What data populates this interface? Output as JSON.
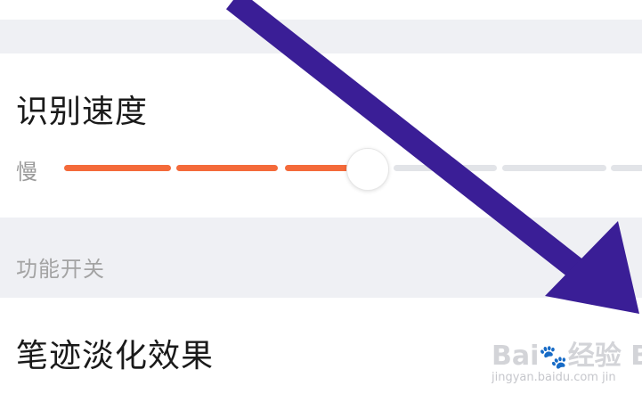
{
  "speed": {
    "title": "识别速度",
    "slow_label": "慢",
    "level": 0.52,
    "colors": {
      "active": "#f46a3a",
      "inactive": "#e2e4e8"
    }
  },
  "features": {
    "section_label": "功能开关",
    "fade_title": "笔迹淡化效果"
  },
  "watermark": {
    "brand": "Bai",
    "brand_cn": "经验",
    "brand_tail": "Ba",
    "url": "jingyan.baidu.com",
    "url_tail": "jin"
  },
  "annotation": {
    "arrow_color": "#3a1e96"
  }
}
